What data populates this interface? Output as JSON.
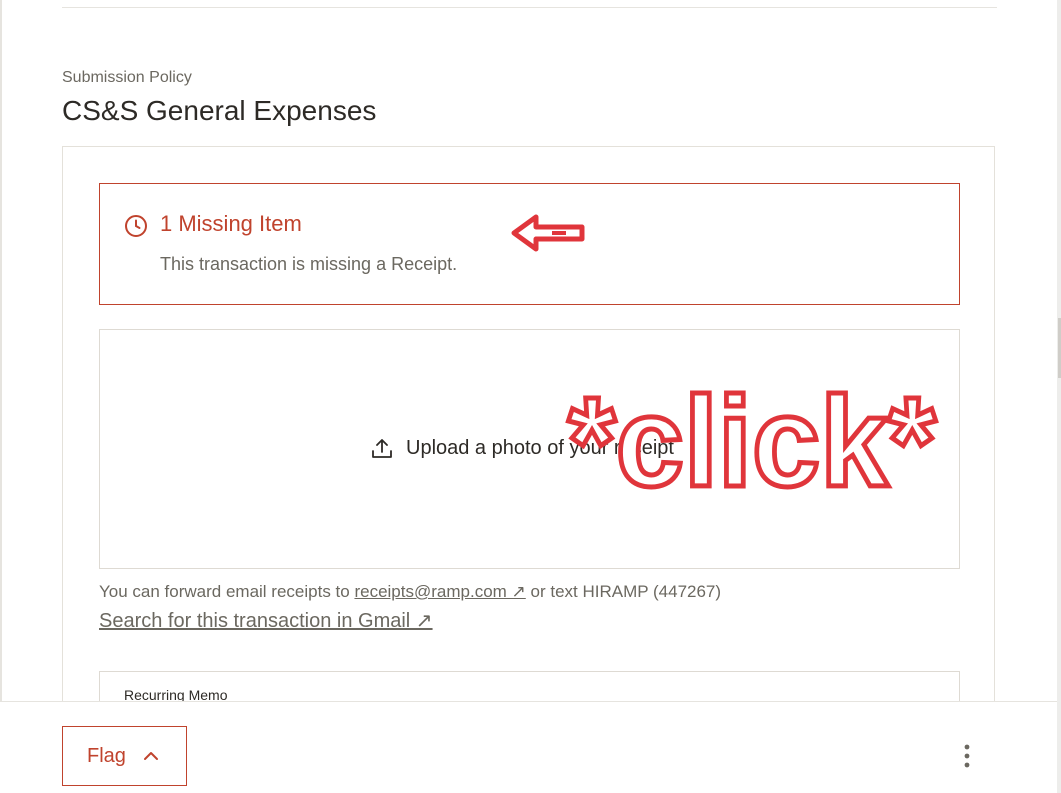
{
  "policy": {
    "label": "Submission Policy",
    "title": "CS&S General Expenses"
  },
  "missing": {
    "icon": "clock-icon",
    "title": "1 Missing Item",
    "description": "This transaction is missing a Receipt."
  },
  "upload": {
    "icon": "upload-icon",
    "label": "Upload a photo of your receipt"
  },
  "forward": {
    "prefix": "You can forward email receipts to ",
    "email_link": "receipts@ramp.com ↗",
    "suffix": " or text HIRAMP (447267)"
  },
  "gmail": {
    "link": "Search for this transaction in Gmail ↗"
  },
  "memo": {
    "label": "Recurring Memo"
  },
  "footer": {
    "flag_label": "Flag",
    "flag_icon": "chevron-up-icon",
    "more_icon": "more-vertical-icon"
  },
  "annotations": {
    "click_text": "*click*",
    "arrow_icon": "left-arrow-annotation"
  },
  "colors": {
    "accent": "#c0432d",
    "muted_text": "#6b6860",
    "text": "#2d2a26"
  }
}
